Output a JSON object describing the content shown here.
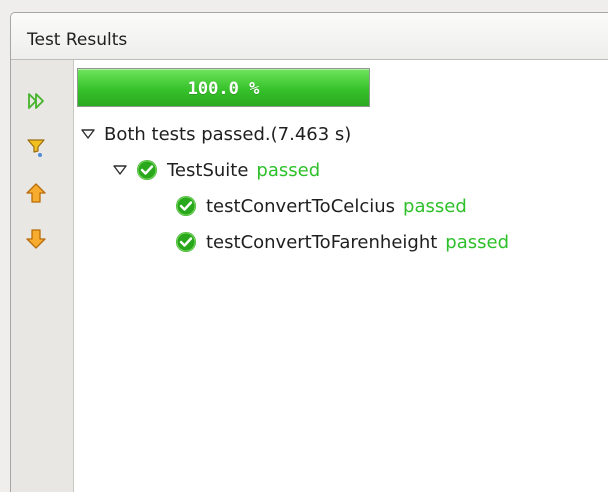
{
  "panel": {
    "title": "Test Results"
  },
  "toolbar": {
    "items": [
      {
        "icon": "rerun-icon"
      },
      {
        "icon": "filter-icon"
      },
      {
        "icon": "arrow-up-icon"
      },
      {
        "icon": "arrow-down-icon"
      }
    ]
  },
  "progress": {
    "percent_label": "100.0 %",
    "value": 1.0
  },
  "results": {
    "summary": "Both tests passed.(7.463 s)",
    "suites": [
      {
        "name": "TestSuite",
        "status": "passed",
        "tests": [
          {
            "name": "testConvertToCelcius",
            "status": "passed"
          },
          {
            "name": "testConvertToFarenheight",
            "status": "passed"
          }
        ]
      }
    ]
  },
  "colors": {
    "progress": "#37c22b",
    "passed_text": "#2ec02a",
    "check_icon": "#2aa81c",
    "toolbar_orange": "#ef9f1a"
  }
}
